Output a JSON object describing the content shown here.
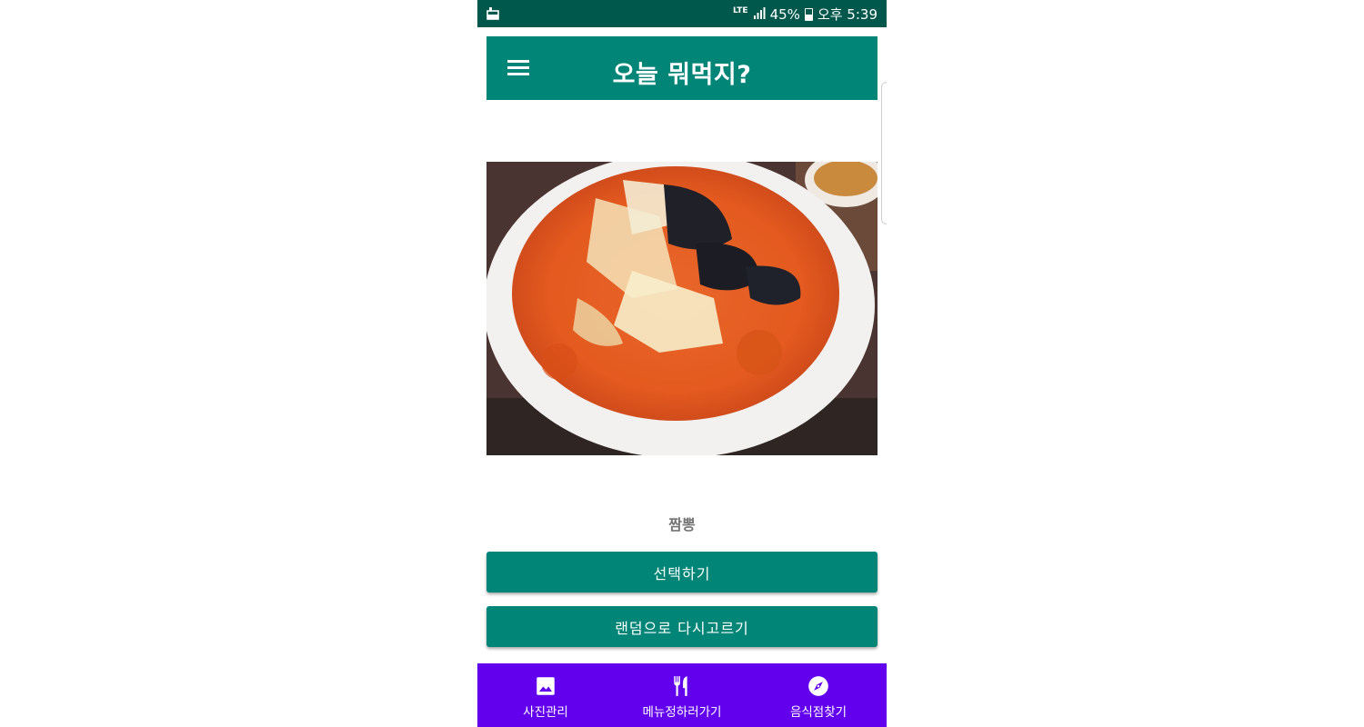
{
  "status_bar": {
    "network": "LTE",
    "battery": "45%",
    "time": "오후 5:39"
  },
  "app_bar": {
    "title": "오늘 뭐먹지?",
    "menu_icon": "hamburger-menu-icon"
  },
  "food": {
    "photo_icon": "food-photo",
    "name": "짬뽕"
  },
  "buttons": {
    "select_label": "선택하기",
    "random_label": "랜덤으로 다시고르기"
  },
  "bottom_nav": {
    "items": [
      {
        "label": "사진관리",
        "icon": "image-icon"
      },
      {
        "label": "메뉴정하러가기",
        "icon": "restaurant-icon"
      },
      {
        "label": "음식점찾기",
        "icon": "compass-icon"
      }
    ]
  },
  "colors": {
    "status_bar": "#00574b",
    "primary": "#008577",
    "bottom_nav": "#6200ee",
    "food_name": "#757575"
  }
}
